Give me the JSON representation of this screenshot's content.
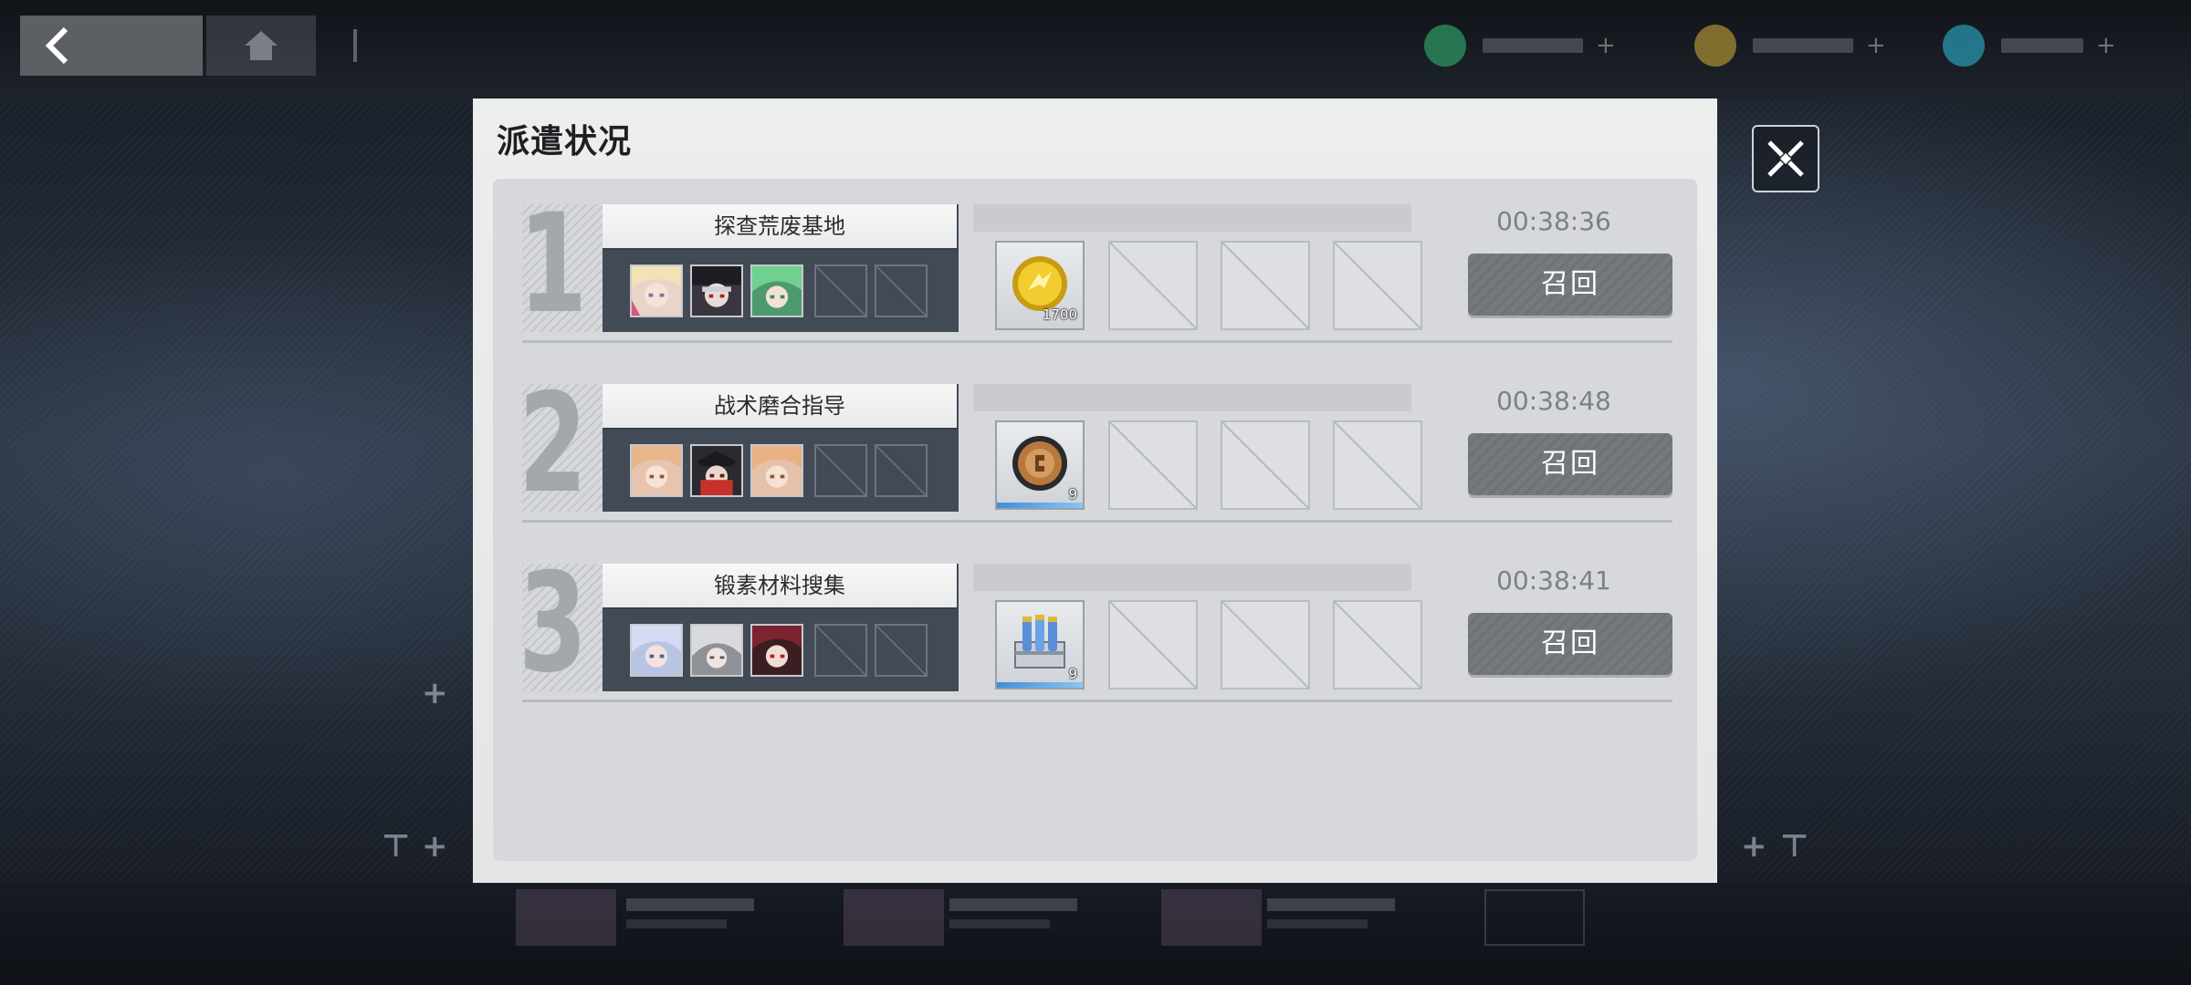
{
  "header": {
    "back_icon": "back-arrow-icon",
    "home_icon": "home-icon",
    "menu_icon": "menu-icon",
    "resources": [
      {
        "icon": "energy-icon",
        "color": "#35c07a"
      },
      {
        "icon": "coin-icon",
        "color": "#d7b33a"
      },
      {
        "icon": "crystal-icon",
        "color": "#2fc3e0"
      }
    ]
  },
  "modal": {
    "title": "派遣状况",
    "close_icon": "close-icon"
  },
  "dispatches": [
    {
      "number": "1",
      "mission": "探查荒废基地",
      "timer": "00:38:36",
      "recall_label": "召回",
      "reward": {
        "icon": "gold-coin-icon",
        "quantity": "1700"
      }
    },
    {
      "number": "2",
      "mission": "战术磨合指导",
      "timer": "00:38:48",
      "recall_label": "召回",
      "reward": {
        "icon": "bronze-medal-icon",
        "quantity": "9"
      }
    },
    {
      "number": "3",
      "mission": "锻素材料搜集",
      "timer": "00:38:41",
      "recall_label": "召回",
      "reward": {
        "icon": "material-crate-icon",
        "quantity": "9"
      }
    }
  ]
}
